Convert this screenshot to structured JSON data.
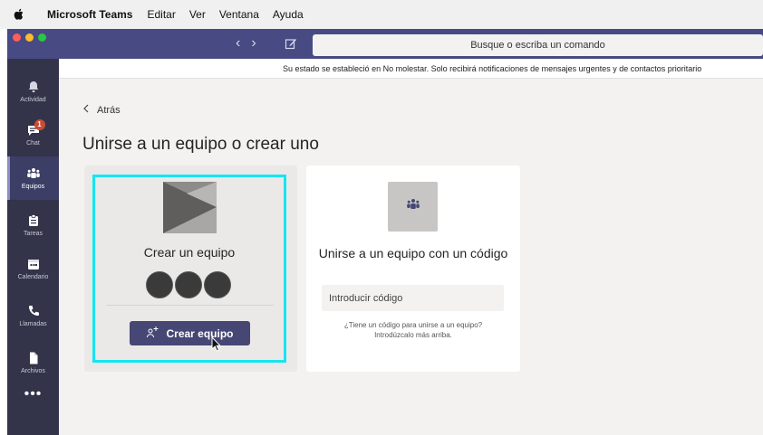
{
  "menubar": {
    "app_name": "Microsoft Teams",
    "items": [
      "Editar",
      "Ver",
      "Ventana",
      "Ayuda"
    ]
  },
  "titlebar": {
    "search_placeholder": "Busque o escriba un comando",
    "traffic_colors": [
      "#fd5f57",
      "#febc2e",
      "#28c840"
    ]
  },
  "rail": {
    "items": [
      {
        "label": "Actividad",
        "icon": "bell-icon"
      },
      {
        "label": "Chat",
        "icon": "chat-icon",
        "badge": "1"
      },
      {
        "label": "Equipos",
        "icon": "teams-icon"
      },
      {
        "label": "Tareas",
        "icon": "tasks-icon"
      },
      {
        "label": "Calendario",
        "icon": "calendar-icon"
      },
      {
        "label": "Llamadas",
        "icon": "phone-icon"
      },
      {
        "label": "Archivos",
        "icon": "files-icon"
      }
    ],
    "more": "•••",
    "active": "Equipos"
  },
  "notice": "Su estado se estableció en No molestar. Solo recibirá notificaciones de mensajes urgentes y de contactos prioritario",
  "main": {
    "back_label": "Atrás",
    "title": "Unirse a un equipo o crear uno"
  },
  "create_card": {
    "title": "Crear un equipo",
    "button_label": "Crear equipo"
  },
  "join_card": {
    "title": "Unirse a un equipo con un código",
    "input_placeholder": "Introducir código",
    "help_line1": "¿Tiene un código para unirse a un equipo?",
    "help_line2": "Introdúzcalo más arriba."
  },
  "colors": {
    "brand": "#464775",
    "titlebar": "#474a83",
    "rail": "#33344a",
    "highlight": "#16e5f2",
    "badge": "#cc4a31"
  }
}
